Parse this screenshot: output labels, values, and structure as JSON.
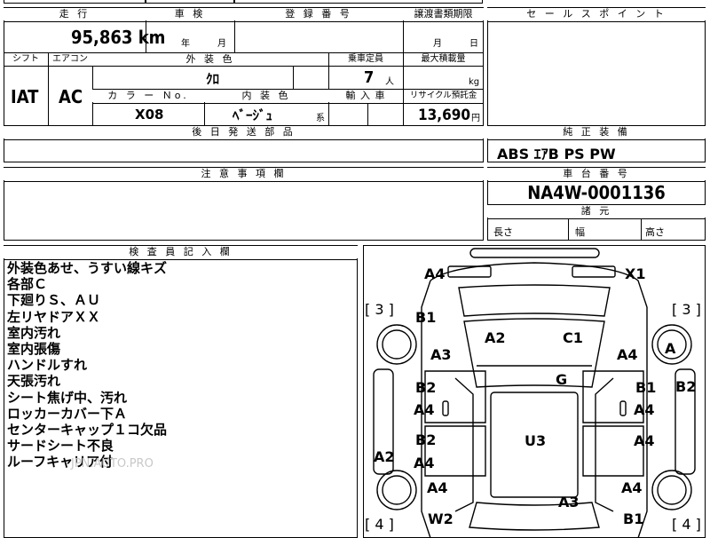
{
  "header": {
    "mileage_label": "走 行",
    "mileage_value": "95,863 km",
    "inspection_label": "車 検",
    "inspection_year": "年",
    "inspection_month": "月",
    "registration_label": "登 録 番 号",
    "transfer_label": "譲渡書類期限",
    "transfer_month": "月",
    "transfer_day": "日",
    "sales_point_label": "セ ー ル ス ポ イ ン ト"
  },
  "specs": {
    "shift_label": "シフト",
    "shift_value": "IAT",
    "ac_label": "エアコン",
    "ac_value": "AC",
    "exterior_label": "外 装 色",
    "exterior_value": "ｸﾛ",
    "capacity_label": "乗車定員",
    "capacity_value": "7",
    "capacity_unit": "人",
    "load_label": "最大積載量",
    "load_unit": "kg",
    "color_no_label": "カ ラ ー Ｎo.",
    "color_no_value": "X08",
    "interior_label": "内 装 色",
    "interior_value": "ﾍﾞｰｼﾞｭ",
    "interior_suffix": "系",
    "import_label": "輸 入 車",
    "recycle_label": "リサイクル預託金",
    "recycle_value": "13,690",
    "recycle_unit": "円",
    "later_parts_label": "後 日 発 送 部 品"
  },
  "equipment": {
    "label": "純 正 装 備",
    "value": "ABS ｴｱB PS PW"
  },
  "caution": {
    "label": "注 意 事 項 欄"
  },
  "chassis": {
    "label": "車 台 番 号",
    "value": "NA4W-0001136",
    "dimensions_label": "諸 元",
    "length_label": "長さ",
    "width_label": "幅",
    "height_label": "高さ"
  },
  "inspector": {
    "label": "検 査 員 記 入 欄",
    "notes": [
      "外装色あせ、うすい線キズ",
      "各部Ｃ",
      "下廻りＳ、ＡＵ",
      "左リヤドアＸＸ",
      "室内汚れ",
      "室内張傷",
      "ハンドルすれ",
      "天張汚れ",
      "シート焦げ中、汚れ",
      "ロッカーカバー下Ａ",
      "センターキャップ１コ欠品",
      "サードシート不良",
      "ルーフキャリア付"
    ],
    "watermark": "JPN.AUTO.PRO"
  },
  "diagram": {
    "marks": {
      "front_bumper": "A4",
      "front_right": "X1",
      "tire_fl": "[ 3 ]",
      "tire_fr": "[ 3 ]",
      "fender_fl_top": "B1",
      "fender_fl": "A3",
      "hood_left": "A2",
      "hood_right": "C1",
      "fender_fr": "A4",
      "wheel_fr": "A",
      "windshield": "G",
      "door_fl_top": "B2",
      "door_fl": "A4",
      "door_fr_top": "B1",
      "door_fr": "A4",
      "rocker_right": "B2",
      "door_rl_top": "B2",
      "door_rl": "A4",
      "roof": "U3",
      "door_rr": "A4",
      "rocker_left": "A2",
      "quarter_rl": "A4",
      "quarter_rr": "A4",
      "rear_glass": "A3",
      "rear_left": "W2",
      "rear_right": "B1",
      "tire_rl": "[ 4 ]",
      "tire_rr": "[ 4 ]"
    }
  }
}
